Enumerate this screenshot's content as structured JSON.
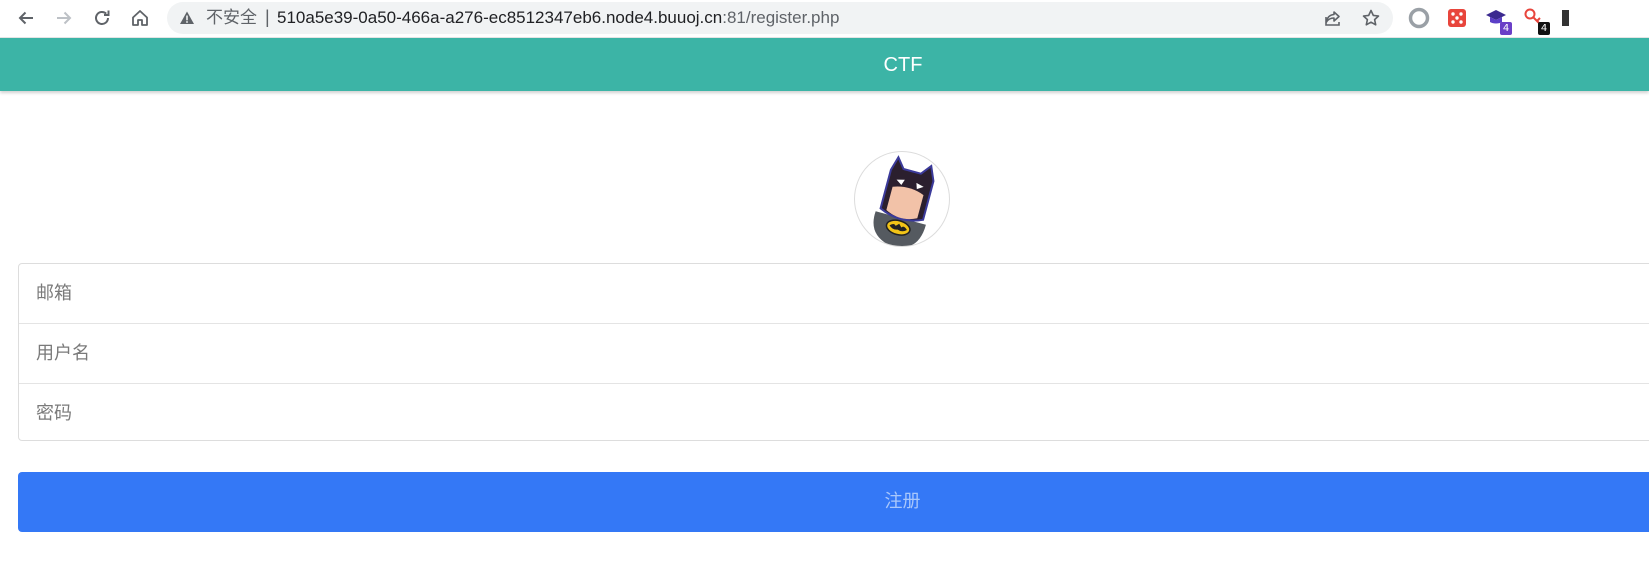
{
  "browser": {
    "security_label": "不安全",
    "url_host": "510a5e39-0a50-466a-a276-ec8512347eb6.node4.buuoj.cn",
    "url_rest": ":81/register.php",
    "extensions": [
      {
        "name": "extension-badge-purple",
        "badge": "4",
        "color": "#6a3fc7"
      },
      {
        "name": "extension-badge-black",
        "badge": "4",
        "color": "#111111"
      }
    ]
  },
  "header": {
    "title": "CTF"
  },
  "form": {
    "email_placeholder": "邮箱",
    "username_placeholder": "用户名",
    "password_placeholder": "密码",
    "submit_label": "注册"
  },
  "colors": {
    "header_bg": "#3cb4a6",
    "button_bg": "#3478f6",
    "button_text": "#a9c7fb"
  },
  "icons": [
    "back-arrow-icon",
    "forward-arrow-icon",
    "reload-icon",
    "home-icon",
    "warning-icon",
    "share-icon",
    "bookmark-star-icon",
    "batman-avatar"
  ]
}
